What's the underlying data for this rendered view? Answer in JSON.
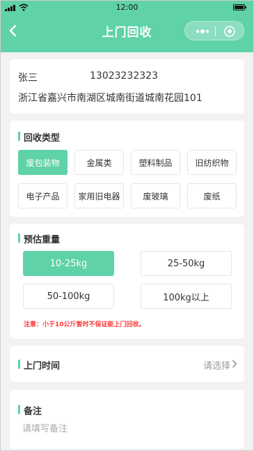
{
  "status_bar": {
    "time": "12:00"
  },
  "nav": {
    "title": "上门回收"
  },
  "address": {
    "name": "张三",
    "phone": "13023232323",
    "detail": "浙江省嘉兴市南湖区城南街道城南花园101"
  },
  "recycle_type": {
    "title": "回收类型",
    "options": [
      "废包装物",
      "金属类",
      "塑料制品",
      "旧纺织物",
      "电子产品",
      "家用旧电器",
      "废玻璃",
      "废纸"
    ],
    "selected": "废包装物"
  },
  "weight": {
    "title": "预估重量",
    "options": [
      "10-25kg",
      "25-50kg",
      "50-100kg",
      "100kg以上"
    ],
    "selected": "10-25kg",
    "notice": "注意：小于10公斤暂时不保证能上门回收。"
  },
  "visit_time": {
    "title": "上门时间",
    "placeholder": "请选择"
  },
  "remark": {
    "title": "备注",
    "placeholder": "请填写备注"
  },
  "colors": {
    "accent": "#5fd2a8",
    "warning": "#ff3b3b"
  }
}
